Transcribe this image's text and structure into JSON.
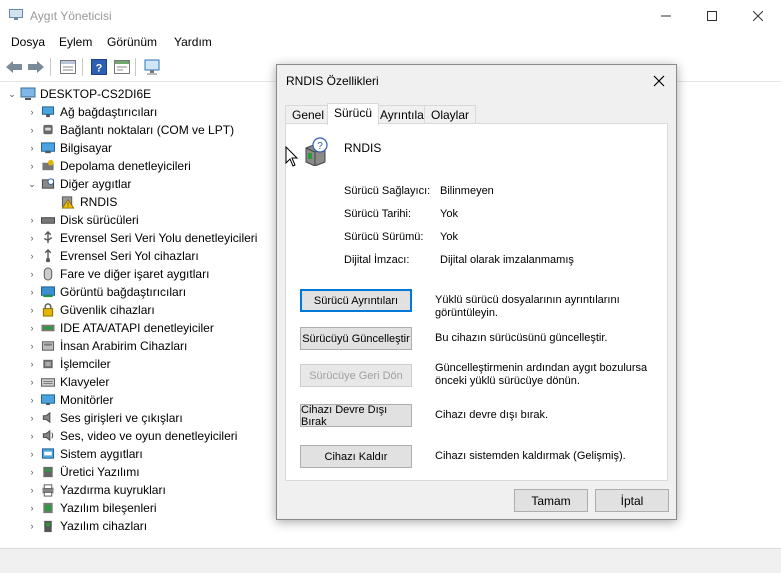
{
  "window": {
    "title": "Aygıt Yöneticisi",
    "controls": {
      "minimize": "—",
      "maximize": "☐",
      "close": "✕"
    }
  },
  "menu": [
    "Dosya",
    "Eylem",
    "Görünüm",
    "Yardım"
  ],
  "tree": {
    "root": "DESKTOP-CS2DI6E",
    "items": [
      {
        "label": "Ağ bağdaştırıcıları",
        "icon": "network-adapter-icon",
        "expanded": false
      },
      {
        "label": "Bağlantı noktaları (COM ve LPT)",
        "icon": "port-icon",
        "expanded": false
      },
      {
        "label": "Bilgisayar",
        "icon": "computer-icon",
        "expanded": false
      },
      {
        "label": "Depolama denetleyicileri",
        "icon": "storage-controller-icon",
        "expanded": false
      },
      {
        "label": "Diğer aygıtlar",
        "icon": "other-devices-icon",
        "expanded": true
      },
      {
        "label": "RNDIS",
        "icon": "warning-device-icon",
        "child": true
      },
      {
        "label": "Disk sürücüleri",
        "icon": "disk-drive-icon",
        "expanded": false
      },
      {
        "label": "Evrensel Seri Veri Yolu denetleyicileri",
        "icon": "usb-icon",
        "expanded": false
      },
      {
        "label": "Evrensel Seri Yol cihazları",
        "icon": "usb-device-icon",
        "expanded": false
      },
      {
        "label": "Fare ve diğer işaret aygıtları",
        "icon": "mouse-icon",
        "expanded": false
      },
      {
        "label": "Görüntü bağdaştırıcıları",
        "icon": "display-adapter-icon",
        "expanded": false
      },
      {
        "label": "Güvenlik cihazları",
        "icon": "security-device-icon",
        "expanded": false
      },
      {
        "label": "IDE ATA/ATAPI denetleyiciler",
        "icon": "ide-icon",
        "expanded": false
      },
      {
        "label": "İnsan Arabirim Cihazları",
        "icon": "hid-icon",
        "expanded": false
      },
      {
        "label": "İşlemciler",
        "icon": "processor-icon",
        "expanded": false
      },
      {
        "label": "Klavyeler",
        "icon": "keyboard-icon",
        "expanded": false
      },
      {
        "label": "Monitörler",
        "icon": "monitor-icon",
        "expanded": false
      },
      {
        "label": "Ses girişleri ve çıkışları",
        "icon": "speaker-icon",
        "expanded": false
      },
      {
        "label": "Ses, video ve oyun denetleyicileri",
        "icon": "audio-icon",
        "expanded": false
      },
      {
        "label": "Sistem aygıtları",
        "icon": "system-device-icon",
        "expanded": false
      },
      {
        "label": "Üretici Yazılımı",
        "icon": "firmware-icon",
        "expanded": false
      },
      {
        "label": "Yazdırma kuyrukları",
        "icon": "print-queue-icon",
        "expanded": false
      },
      {
        "label": "Yazılım bileşenleri",
        "icon": "software-component-icon",
        "expanded": false
      },
      {
        "label": "Yazılım cihazları",
        "icon": "software-device-icon",
        "expanded": false
      }
    ]
  },
  "dialog": {
    "title": "RNDIS Özellikleri",
    "close": "✕",
    "tabs": [
      "Genel",
      "Sürücü",
      "Ayrıntılar",
      "Olaylar"
    ],
    "active_tab": "Sürücü",
    "device_name": "RNDIS",
    "fields": [
      {
        "label": "Sürücü Sağlayıcı:",
        "value": "Bilinmeyen"
      },
      {
        "label": "Sürücü Tarihi:",
        "value": "Yok"
      },
      {
        "label": "Sürücü Sürümü:",
        "value": "Yok"
      },
      {
        "label": "Dijital İmzacı:",
        "value": "Dijital olarak imzalanmamış"
      }
    ],
    "actions": [
      {
        "label": "Sürücü Ayrıntıları",
        "desc": "Yüklü sürücü dosyalarının ayrıntılarını görüntüleyin.",
        "state": "focused"
      },
      {
        "label": "Sürücüyü Güncelleştir",
        "desc": "Bu cihazın sürücüsünü güncelleştir.",
        "state": "normal"
      },
      {
        "label": "Sürücüye Geri Dön",
        "desc": "Güncelleştirmenin ardından aygıt bozulursa önceki yüklü sürücüye dönün.",
        "state": "disabled"
      },
      {
        "label": "Cihazı Devre Dışı Bırak",
        "desc": "Cihazı devre dışı bırak.",
        "state": "normal"
      },
      {
        "label": "Cihazı Kaldır",
        "desc": "Cihazı sistemden kaldırmak (Gelişmiş).",
        "state": "normal"
      }
    ],
    "ok": "Tamam",
    "cancel": "İptal"
  }
}
